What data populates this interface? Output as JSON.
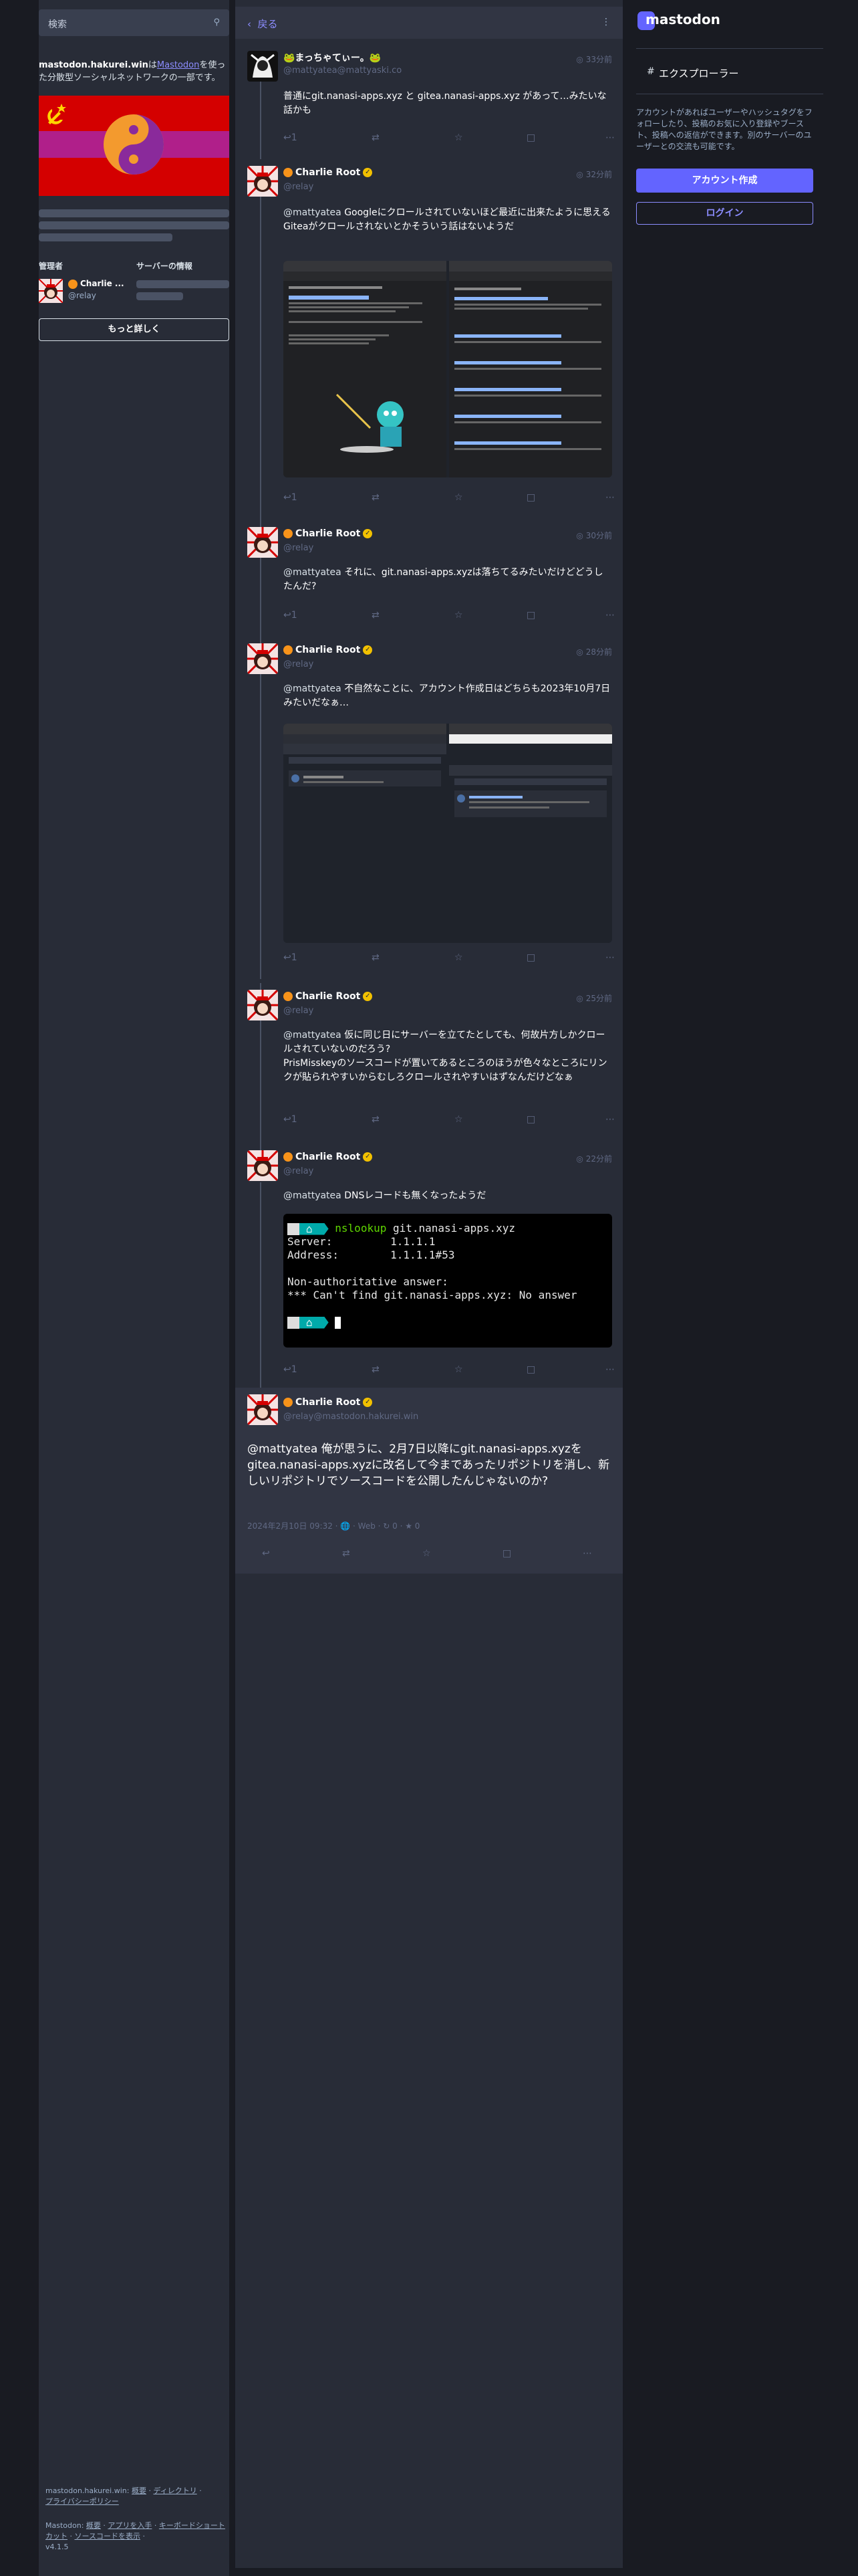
{
  "search": {
    "placeholder": "検索",
    "icon": "search-icon"
  },
  "server": {
    "domain": "mastodon.hakurei.win",
    "desc_mid": "は",
    "link": "Mastodon",
    "desc_tail": "を使った分散型ソーシャルネットワークの一部です。",
    "admin_label": "管理者",
    "info_label": "サーバーの情報",
    "admin_name": "Charlie ...",
    "admin_handle": "@relay",
    "more_button": "もっと詳しく"
  },
  "footer": {
    "line1_domain": "mastodon.hakurei.win:",
    "about": "概要",
    "dot": "·",
    "directory": "ディレクトリ",
    "privacy": "プライバシーポリシー",
    "line2_prefix": "Mastodon:",
    "about2": "概要",
    "get_app": "アプリを入手",
    "shortcuts": "キーボードショートカット",
    "source": "ソースコードを表示",
    "version": "v4.1.5"
  },
  "header": {
    "back": "戻る"
  },
  "statuses": [
    {
      "name": "🐸まっちゃてぃー。🐸",
      "handle": "@mattyatea@mattyaski.co",
      "time": "33分前",
      "text": "普通にgit.nanasi-apps.xyz と gitea.nanasi-apps.xyz があって…みたいな話かも",
      "replies": "1"
    },
    {
      "name": "Charlie Root",
      "handle": "@relay",
      "time": "32分前",
      "mention": "@mattyatea",
      "text": " Googleにクロールされていないほど最近に出来たように思える\nGiteaがクロールされないとかそういう話はないようだ",
      "replies": "1"
    },
    {
      "name": "Charlie Root",
      "handle": "@relay",
      "time": "30分前",
      "mention": "@mattyatea",
      "text": " それに、git.nanasi-apps.xyzは落ちてるみたいだけどどうしたんだ?",
      "replies": "1"
    },
    {
      "name": "Charlie Root",
      "handle": "@relay",
      "time": "28分前",
      "mention": "@mattyatea",
      "text": " 不自然なことに、アカウント作成日はどちらも2023年10月7日みたいだなぁ…",
      "replies": "1"
    },
    {
      "name": "Charlie Root",
      "handle": "@relay",
      "time": "25分前",
      "mention": "@mattyatea",
      "text": " 仮に同じ日にサーバーを立てたとしても、何故片方しかクロールされていないのだろう?\nPrisMisskeyのソースコードが置いてあるところのほうが色々なところにリンクが貼られやすいからむしろクロールされやすいはずなんだけどなぁ",
      "replies": "1"
    },
    {
      "name": "Charlie Root",
      "handle": "@relay",
      "time": "22分前",
      "mention": "@mattyatea",
      "text": " DNSレコードも無くなったようだ",
      "replies": "1"
    }
  ],
  "terminal": {
    "cmd": "nslookup",
    "arg": " git.nanasi-apps.xyz",
    "server_line": "Server:         1.1.1.1",
    "address_line": "Address:        1.1.1.1#53",
    "nonauth": "Non-authoritative answer:",
    "error": "*** Can't find git.nanasi-apps.xyz: No answer"
  },
  "focused": {
    "name": "Charlie Root",
    "handle": "@relay@mastodon.hakurei.win",
    "mention": "@mattyatea",
    "text": " 俺が思うに、2月7日以降にgit.nanasi-apps.xyzをgitea.nanasi-apps.xyzに改名して今まであったリポジトリを消し、新しいリポジトリでソースコードを公開したんじゃないのか?",
    "meta": "2024年2月10日 09:32 · 🌐 · Web · ↻ 0 · ★ 0"
  },
  "right": {
    "logo": "mastodon",
    "explore": "エクスプローラー",
    "desc": "アカウントがあればユーザーやハッシュタグをフォローしたり、投稿のお気に入り登録やブースト、投稿への返信ができます。別のサーバーのユーザーとの交流も可能です。",
    "signup": "アカウント作成",
    "login": "ログイン"
  },
  "colors": {
    "accent": "#6364ff",
    "link": "#8c8dff",
    "bg": "#191b22",
    "panel": "#282c37"
  }
}
